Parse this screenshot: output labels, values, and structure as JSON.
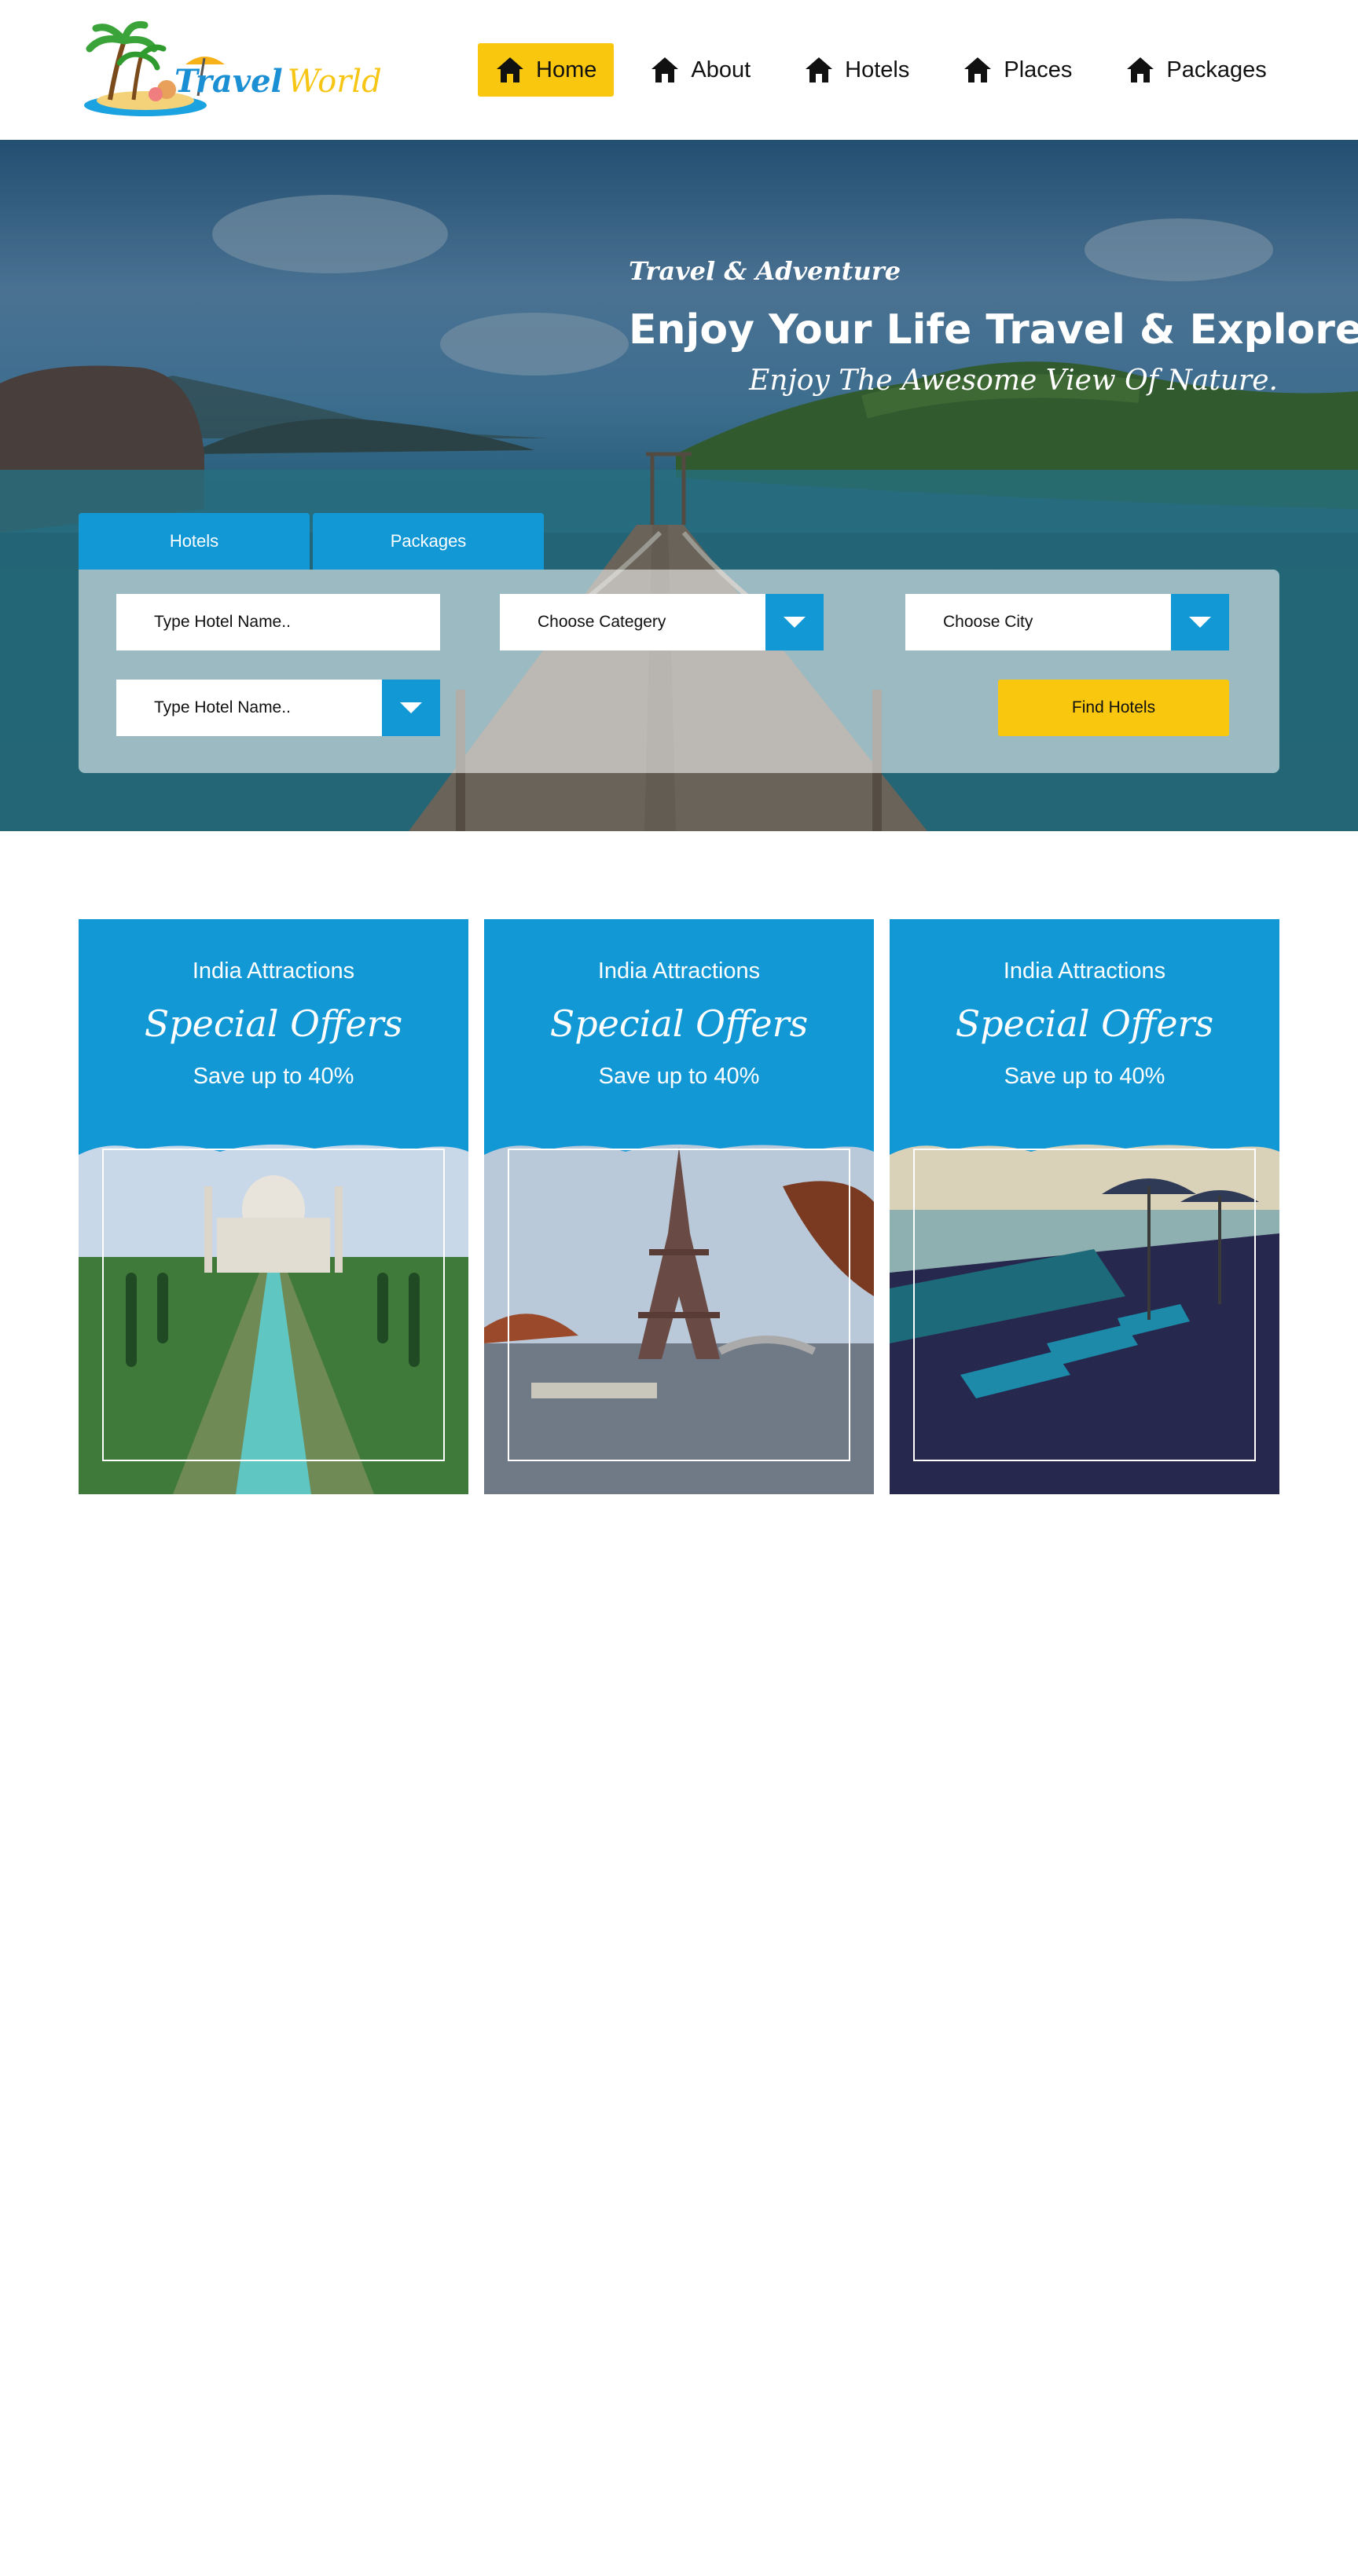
{
  "brand": {
    "name_part1": "Travel",
    "name_part2": "World"
  },
  "nav": {
    "items": [
      {
        "label": "Home",
        "active": true,
        "icon": "home-icon"
      },
      {
        "label": "About",
        "active": false,
        "icon": "home-icon"
      },
      {
        "label": "Hotels",
        "active": false,
        "icon": "home-icon"
      },
      {
        "label": "Places",
        "active": false,
        "icon": "home-icon"
      },
      {
        "label": "Packages",
        "active": false,
        "icon": "home-icon"
      }
    ]
  },
  "hero": {
    "kicker": "Travel & Adventure",
    "title": "Enjoy Your Life Travel & Explore",
    "subtitle": "Enjoy The Awesome View Of Nature."
  },
  "search": {
    "tabs": [
      "Hotels",
      "Packages"
    ],
    "hotel_name_placeholder": "Type Hotel Name..",
    "category_placeholder": "Choose Categery",
    "city_placeholder": "Choose City",
    "hotel_name2_placeholder": "Type Hotel Name..",
    "find_button": "Find Hotels"
  },
  "offers": [
    {
      "kicker": "India Attractions",
      "title": "Special Offers",
      "discount": "Save up to 40%"
    },
    {
      "kicker": "India Attractions",
      "title": "Special Offers",
      "discount": "Save up to 40%"
    },
    {
      "kicker": "India Attractions",
      "title": "Special Offers",
      "discount": "Save up to 40%"
    }
  ],
  "colors": {
    "primary_blue": "#1398d6",
    "accent_yellow": "#f9c80e",
    "text_dark": "#111111",
    "white": "#ffffff"
  }
}
